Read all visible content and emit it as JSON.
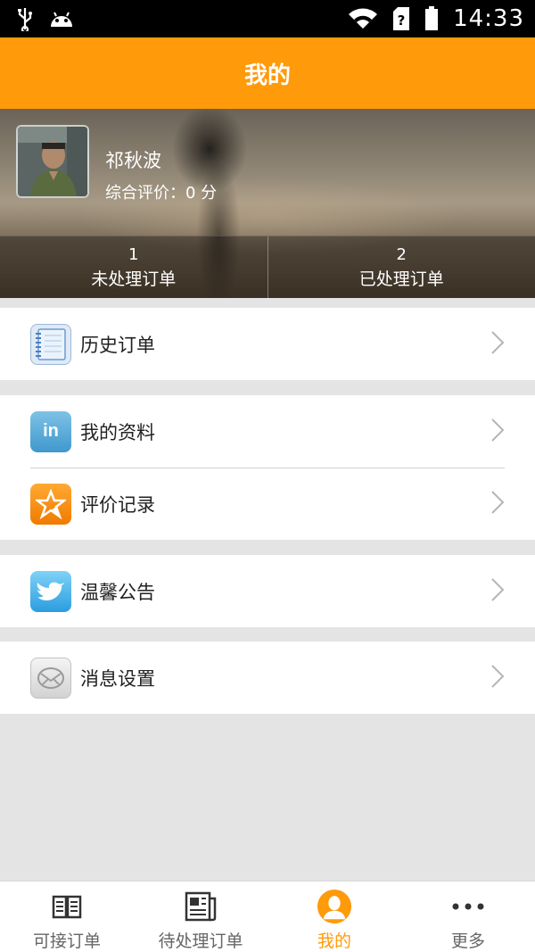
{
  "status_bar": {
    "time": "14:33",
    "icons": [
      "usb-icon",
      "android-icon",
      "wifi-icon",
      "sim-unknown-icon",
      "battery-icon"
    ]
  },
  "header": {
    "title": "我的"
  },
  "profile": {
    "name": "祁秋波",
    "rating": "综合评价：0 分",
    "stats": [
      {
        "count": "1",
        "label": "未处理订单"
      },
      {
        "count": "2",
        "label": "已处理订单"
      }
    ]
  },
  "menu": {
    "history": {
      "label": "历史订单",
      "icon": "notebook-icon"
    },
    "profile_info": {
      "label": "我的资料",
      "icon": "linkedin-icon"
    },
    "reviews": {
      "label": "评价记录",
      "icon": "star-icon"
    },
    "notice": {
      "label": "温馨公告",
      "icon": "bird-icon"
    },
    "message_settings": {
      "label": "消息设置",
      "icon": "mail-icon"
    }
  },
  "bottom_nav": {
    "items": [
      {
        "label": "可接订单",
        "icon": "open-book-icon",
        "active": false
      },
      {
        "label": "待处理订单",
        "icon": "newspaper-icon",
        "active": false
      },
      {
        "label": "我的",
        "icon": "user-icon",
        "active": true
      },
      {
        "label": "更多",
        "icon": "more-dots-icon",
        "active": false
      }
    ]
  },
  "colors": {
    "accent": "#ff9a0a",
    "status_bar": "#000000",
    "background": "#e4e4e4"
  }
}
